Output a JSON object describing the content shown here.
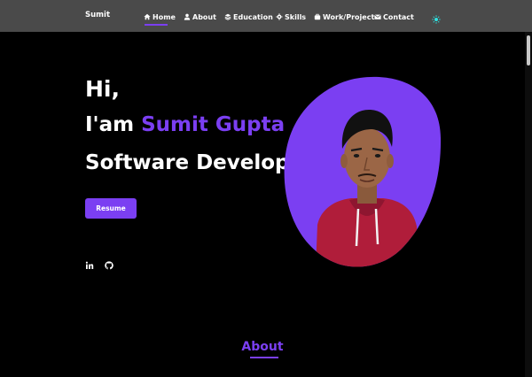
{
  "brand": "Sumit",
  "nav": {
    "home": "Home",
    "about": "About",
    "education": "Education",
    "skills": "Skills",
    "work": "Work/Project",
    "contact": "Contact"
  },
  "hero": {
    "greeting": "Hi,",
    "intro_prefix": "I'am",
    "name": "Sumit Gupta",
    "role": "Software Developer",
    "resume_label": "Resume"
  },
  "social": {
    "linkedin_icon": "linkedin-icon",
    "github_icon": "github-icon"
  },
  "about": {
    "title": "About"
  },
  "colors": {
    "accent": "#7b3ff2",
    "nav_bg": "#4a4a4a",
    "page_bg": "#000000"
  }
}
